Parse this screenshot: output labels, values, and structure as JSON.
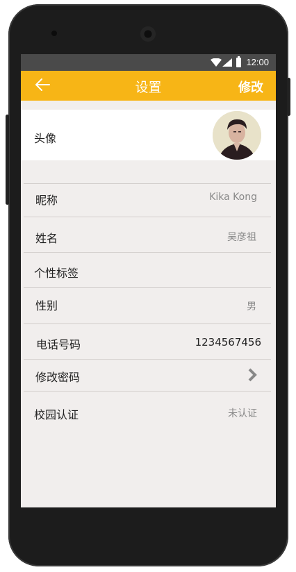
{
  "statusbar": {
    "time": "12:00",
    "icons": [
      "wifi-icon",
      "signal-icon",
      "battery-icon"
    ],
    "background": "#4a4a4a"
  },
  "appbar": {
    "title": "设置",
    "back_icon": "arrow-left-icon",
    "edit_label": "修改",
    "background": "#f7b516"
  },
  "profile": {
    "avatar_label": "头像",
    "avatar_icon": "user-avatar",
    "nickname_label": "昵称",
    "nickname_value": "Kika Kong",
    "name_label": "姓名",
    "name_value": "吴彦祖",
    "tag_label": "个性标签",
    "gender_label": "性别",
    "gender_value": "男",
    "phone_label": "电话号码",
    "phone_value": "1234567456",
    "password_label": "修改密码",
    "password_icon": "chevron-right-icon",
    "campus_label": "校园认证",
    "campus_value": "未认证"
  },
  "colors": {
    "accent": "#f7b516",
    "background": "#f1eeed"
  }
}
